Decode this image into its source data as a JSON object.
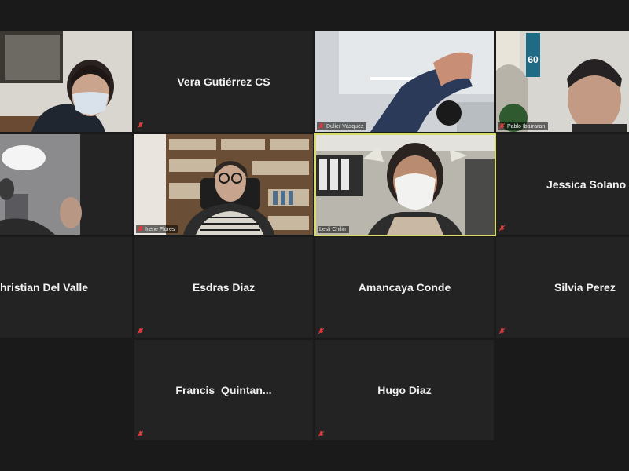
{
  "colors": {
    "app_bg": "#1a1a1a",
    "tile_bg": "#232323",
    "active_speaker_border": "#d8dc6a",
    "muted_mic": "#e03a3a",
    "name_text": "#f2f2f2"
  },
  "participants": [
    {
      "name": "",
      "has_video": true,
      "muted": false
    },
    {
      "name": "Vera Gutiérrez CS",
      "has_video": false,
      "muted": true
    },
    {
      "name": "Dulier Vásquez",
      "has_video": true,
      "muted": true
    },
    {
      "name": "Pablo Ibarraran",
      "has_video": true,
      "muted": true
    },
    {
      "name": "",
      "has_video": true,
      "muted": false
    },
    {
      "name": "Irene Flores",
      "has_video": true,
      "muted": true
    },
    {
      "name": "Lesli Chilin",
      "has_video": true,
      "muted": false,
      "active_speaker": true
    },
    {
      "name": "Jessica Solano",
      "has_video": false,
      "muted": true
    },
    {
      "name": "hristian Del Valle",
      "has_video": false,
      "muted": false
    },
    {
      "name": "Esdras Diaz",
      "has_video": false,
      "muted": true
    },
    {
      "name": "Amancaya Conde",
      "has_video": false,
      "muted": true
    },
    {
      "name": "Silvia Perez",
      "has_video": false,
      "muted": true
    },
    {
      "name": "Francis  Quintan...",
      "has_video": false,
      "muted": true
    },
    {
      "name": "Hugo Diaz",
      "has_video": false,
      "muted": true
    }
  ],
  "scene_text": {
    "badge_60": "60"
  }
}
